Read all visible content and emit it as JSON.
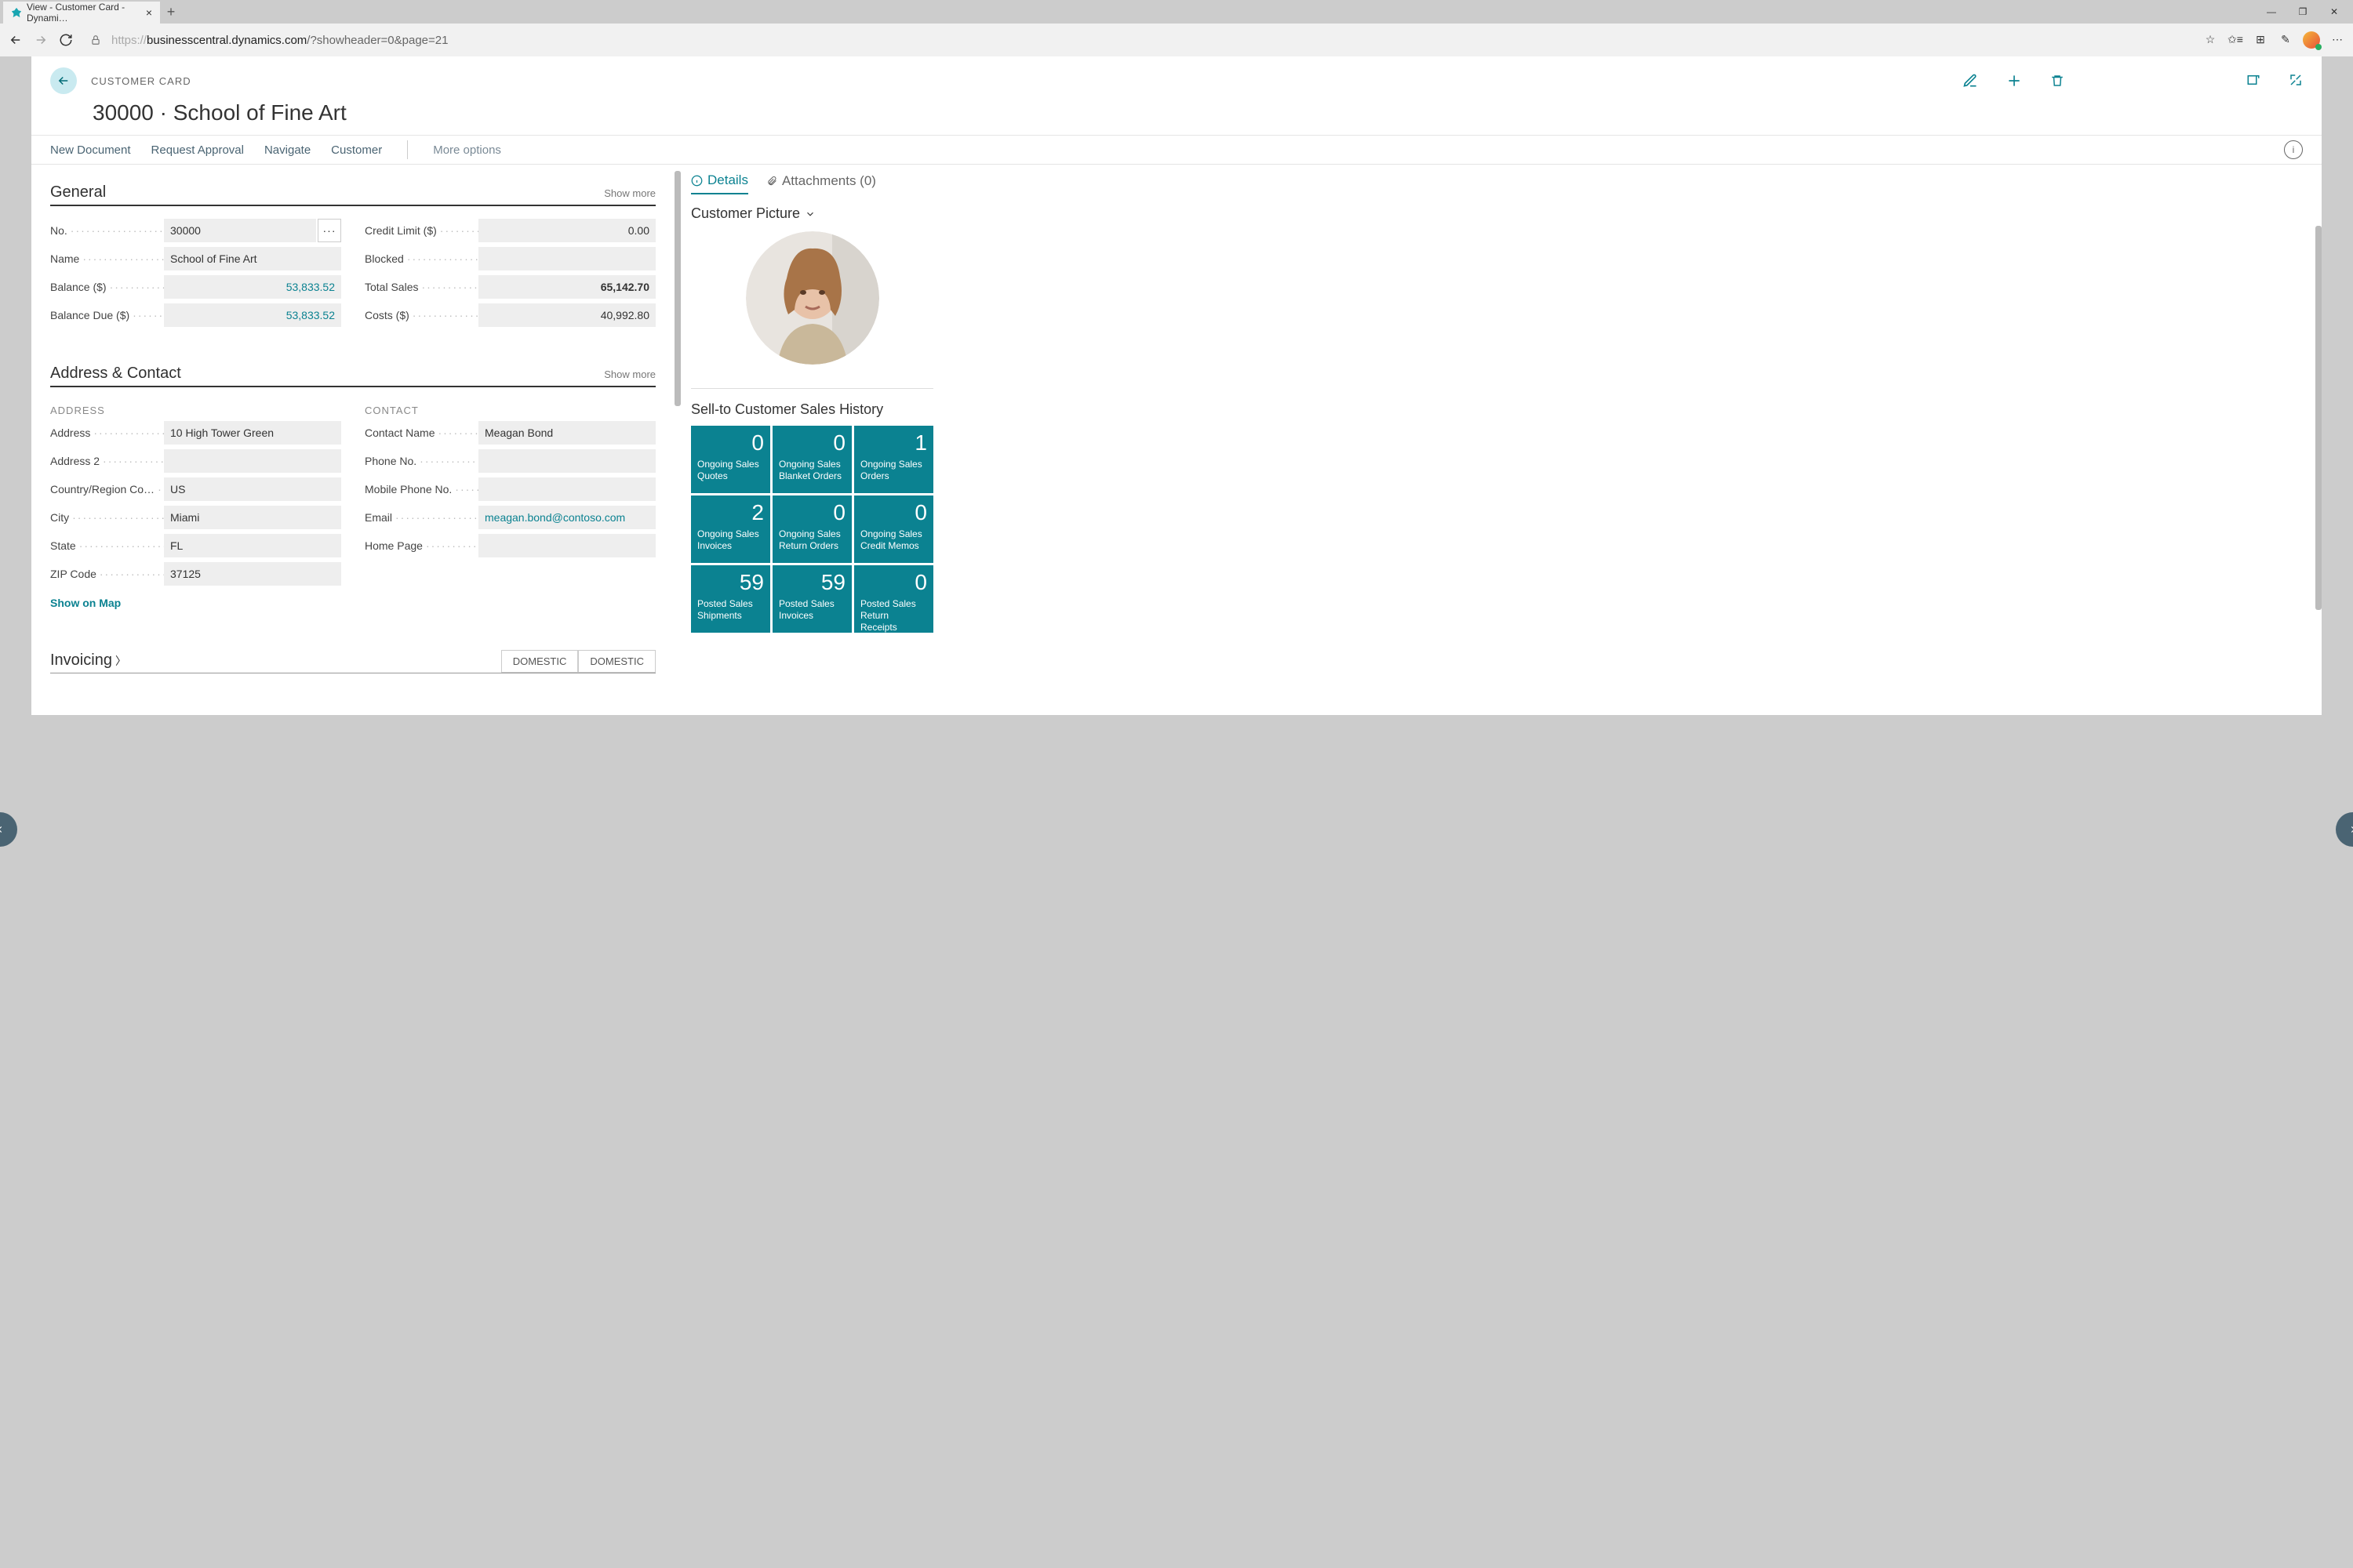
{
  "browser": {
    "tab_title": "View - Customer Card - Dynami…",
    "url_host": "businesscentral.dynamics.com",
    "url_path": "/?showheader=0&page=21"
  },
  "header": {
    "breadcrumb": "CUSTOMER CARD",
    "title": "30000 · School of Fine Art"
  },
  "menu": {
    "new_document": "New Document",
    "request_approval": "Request Approval",
    "navigate": "Navigate",
    "customer": "Customer",
    "more_options": "More options"
  },
  "general": {
    "title": "General",
    "show_more": "Show more",
    "labels": {
      "no": "No.",
      "name": "Name",
      "balance": "Balance ($)",
      "balance_due": "Balance Due ($)",
      "credit_limit": "Credit Limit ($)",
      "blocked": "Blocked",
      "total_sales": "Total Sales",
      "costs": "Costs ($)"
    },
    "values": {
      "no": "30000",
      "name": "School of Fine Art",
      "balance": "53,833.52",
      "balance_due": "53,833.52",
      "credit_limit": "0.00",
      "blocked": "",
      "total_sales": "65,142.70",
      "costs": "40,992.80"
    }
  },
  "address_contact": {
    "title": "Address & Contact",
    "show_more": "Show more",
    "address_heading": "ADDRESS",
    "contact_heading": "CONTACT",
    "labels": {
      "address": "Address",
      "address2": "Address 2",
      "country": "Country/Region Co…",
      "city": "City",
      "state": "State",
      "zip": "ZIP Code",
      "contact_name": "Contact Name",
      "phone": "Phone No.",
      "mobile": "Mobile Phone No.",
      "email": "Email",
      "homepage": "Home Page"
    },
    "values": {
      "address": "10 High Tower Green",
      "address2": "",
      "country": "US",
      "city": "Miami",
      "state": "FL",
      "zip": "37125",
      "contact_name": "Meagan Bond",
      "phone": "",
      "mobile": "",
      "email": "meagan.bond@contoso.com",
      "homepage": ""
    },
    "show_on_map": "Show on Map"
  },
  "invoicing": {
    "title": "Invoicing",
    "tag1": "DOMESTIC",
    "tag2": "DOMESTIC"
  },
  "side": {
    "details_tab": "Details",
    "attachments_tab": "Attachments (0)",
    "customer_picture": "Customer Picture",
    "sales_history": "Sell-to Customer Sales History",
    "tiles": [
      {
        "value": "0",
        "label": "Ongoing Sales Quotes"
      },
      {
        "value": "0",
        "label": "Ongoing Sales Blanket Orders"
      },
      {
        "value": "1",
        "label": "Ongoing Sales Orders"
      },
      {
        "value": "2",
        "label": "Ongoing Sales Invoices"
      },
      {
        "value": "0",
        "label": "Ongoing Sales Return Orders"
      },
      {
        "value": "0",
        "label": "Ongoing Sales Credit Memos"
      },
      {
        "value": "59",
        "label": "Posted Sales Shipments"
      },
      {
        "value": "59",
        "label": "Posted Sales Invoices"
      },
      {
        "value": "0",
        "label": "Posted Sales Return Receipts"
      }
    ]
  }
}
